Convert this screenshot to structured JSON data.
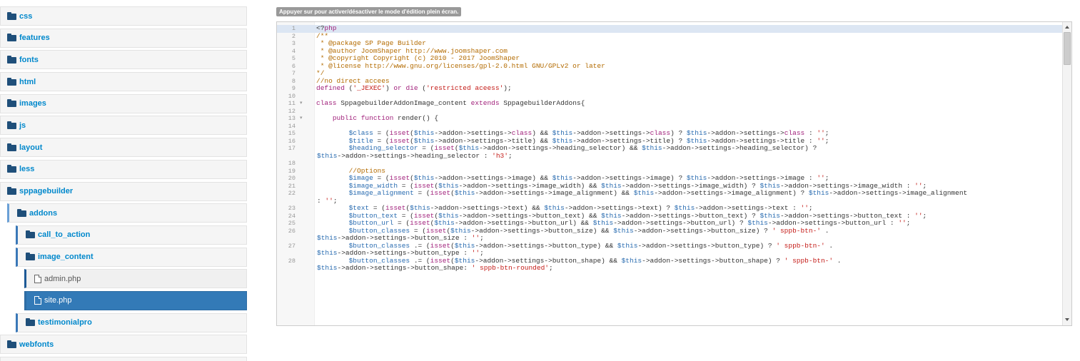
{
  "tree": [
    {
      "label": "css",
      "level": 0,
      "type": "folder"
    },
    {
      "label": "features",
      "level": 0,
      "type": "folder"
    },
    {
      "label": "fonts",
      "level": 0,
      "type": "folder"
    },
    {
      "label": "html",
      "level": 0,
      "type": "folder"
    },
    {
      "label": "images",
      "level": 0,
      "type": "folder"
    },
    {
      "label": "js",
      "level": 0,
      "type": "folder"
    },
    {
      "label": "layout",
      "level": 0,
      "type": "folder"
    },
    {
      "label": "less",
      "level": 0,
      "type": "folder"
    },
    {
      "label": "sppagebuilder",
      "level": 0,
      "type": "folder"
    },
    {
      "label": "addons",
      "level": 1,
      "type": "folder"
    },
    {
      "label": "call_to_action",
      "level": 2,
      "type": "folder"
    },
    {
      "label": "image_content",
      "level": 2,
      "type": "folder"
    },
    {
      "label": "admin.php",
      "level": 3,
      "type": "file"
    },
    {
      "label": "site.php",
      "level": 3,
      "type": "file",
      "active": true
    },
    {
      "label": "testimonialpro",
      "level": 2,
      "type": "folder"
    },
    {
      "label": "webfonts",
      "level": 0,
      "type": "folder"
    }
  ],
  "editor": {
    "hint": "Appuyer sur pour activer/désactiver le mode d'édition plein écran.",
    "lines": [
      {
        "n": "1",
        "t": "<?php",
        "c": "kw",
        "active": true
      },
      {
        "n": "2",
        "t": "/**",
        "c": "cm"
      },
      {
        "n": "3",
        "t": " * @package SP Page Builder",
        "c": "cm"
      },
      {
        "n": "4",
        "t": " * @author JoomShaper http://www.joomshaper.com",
        "c": "cm"
      },
      {
        "n": "5",
        "t": " * @copyright Copyright (c) 2010 - 2017 JoomShaper",
        "c": "cm"
      },
      {
        "n": "6",
        "t": " * @license http://www.gnu.org/licenses/gpl-2.0.html GNU/GPLv2 or later",
        "c": "cm"
      },
      {
        "n": "7",
        "t": "*/",
        "c": "cm"
      },
      {
        "n": "8",
        "t": "//no direct accees",
        "c": "cm"
      },
      {
        "n": "9",
        "t": "defined ('_JEXEC') or die ('restricted aceess');",
        "c": "mix"
      },
      {
        "n": "10",
        "t": "",
        "c": "op"
      },
      {
        "n": "11",
        "t": "class SppagebuilderAddonImage_content extends SppagebuilderAddons{",
        "c": "kw",
        "fold": true
      },
      {
        "n": "12",
        "t": "",
        "c": "op"
      },
      {
        "n": "13",
        "t": "    public function render() {",
        "c": "kw",
        "fold": true
      },
      {
        "n": "14",
        "t": "",
        "c": "op"
      },
      {
        "n": "15",
        "t": "        $class = (isset($this->addon->settings->class) && $this->addon->settings->class) ? $this->addon->settings->class : '';",
        "c": "mix"
      },
      {
        "n": "16",
        "t": "        $title = (isset($this->addon->settings->title) && $this->addon->settings->title) ? $this->addon->settings->title : '';",
        "c": "mix"
      },
      {
        "n": "17",
        "t": "        $heading_selector = (isset($this->addon->settings->heading_selector) && $this->addon->settings->heading_selector) ?",
        "c": "mix"
      },
      {
        "n": "",
        "t": "$this->addon->settings->heading_selector : 'h3';",
        "c": "mix",
        "wrap": true
      },
      {
        "n": "18",
        "t": "",
        "c": "op"
      },
      {
        "n": "19",
        "t": "        //Options",
        "c": "cm"
      },
      {
        "n": "20",
        "t": "        $image = (isset($this->addon->settings->image) && $this->addon->settings->image) ? $this->addon->settings->image : '';",
        "c": "mix"
      },
      {
        "n": "21",
        "t": "        $image_width = (isset($this->addon->settings->image_width) && $this->addon->settings->image_width) ? $this->addon->settings->image_width : '';",
        "c": "mix"
      },
      {
        "n": "22",
        "t": "        $image_alignment = (isset($this->addon->settings->image_alignment) && $this->addon->settings->image_alignment) ? $this->addon->settings->image_alignment",
        "c": "mix"
      },
      {
        "n": "",
        "t": ": '';",
        "c": "mix",
        "wrap": true
      },
      {
        "n": "23",
        "t": "        $text = (isset($this->addon->settings->text) && $this->addon->settings->text) ? $this->addon->settings->text : '';",
        "c": "mix"
      },
      {
        "n": "24",
        "t": "        $button_text = (isset($this->addon->settings->button_text) && $this->addon->settings->button_text) ? $this->addon->settings->button_text : '';",
        "c": "mix"
      },
      {
        "n": "25",
        "t": "        $button_url = (isset($this->addon->settings->button_url) && $this->addon->settings->button_url) ? $this->addon->settings->button_url : '';",
        "c": "mix"
      },
      {
        "n": "26",
        "t": "        $button_classes = (isset($this->addon->settings->button_size) && $this->addon->settings->button_size) ? ' sppb-btn-' .",
        "c": "mix"
      },
      {
        "n": "",
        "t": "$this->addon->settings->button_size : '';",
        "c": "mix",
        "wrap": true
      },
      {
        "n": "27",
        "t": "        $button_classes .= (isset($this->addon->settings->button_type) && $this->addon->settings->button_type) ? ' sppb-btn-' .",
        "c": "mix"
      },
      {
        "n": "",
        "t": "$this->addon->settings->button_type : '';",
        "c": "mix",
        "wrap": true
      },
      {
        "n": "28",
        "t": "        $button_classes .= (isset($this->addon->settings->button_shape) && $this->addon->settings->button_shape) ? ' sppb-btn-' .",
        "c": "mix"
      },
      {
        "n": "",
        "t": "$this->addon->settings->button_shape: ' sppb-btn-rounded';",
        "c": "mix",
        "wrap": true
      }
    ]
  },
  "colors": {
    "accent": "#337ab7",
    "link": "#0088cc",
    "comment": "#b36b00",
    "keyword": "#a01f7a",
    "string": "#c41a16",
    "variable": "#286bb0"
  }
}
